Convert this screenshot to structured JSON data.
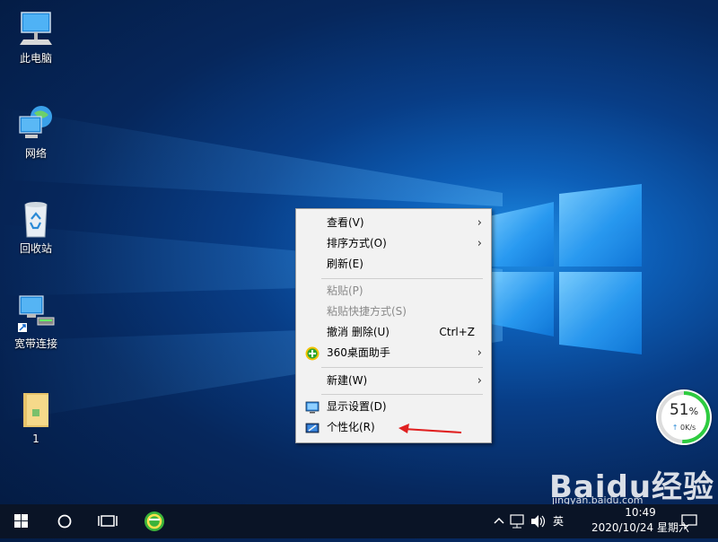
{
  "desktop": {
    "icons": [
      {
        "label": "此电脑",
        "icon": "computer-icon"
      },
      {
        "label": "网络",
        "icon": "network-icon"
      },
      {
        "label": "回收站",
        "icon": "recycle-bin-icon"
      },
      {
        "label": "宽带连接",
        "icon": "broadband-connection-icon"
      },
      {
        "label": "1",
        "icon": "folder-icon"
      }
    ]
  },
  "context_menu": {
    "items": [
      {
        "label": "查看(V)",
        "submenu": true,
        "disabled": false
      },
      {
        "label": "排序方式(O)",
        "submenu": true,
        "disabled": false
      },
      {
        "label": "刷新(E)",
        "submenu": false,
        "disabled": false
      },
      {
        "label": "粘贴(P)",
        "submenu": false,
        "disabled": true
      },
      {
        "label": "粘贴快捷方式(S)",
        "submenu": false,
        "disabled": true
      },
      {
        "label": "撤消 删除(U)",
        "shortcut": "Ctrl+Z",
        "submenu": false,
        "disabled": false
      },
      {
        "label": "360桌面助手",
        "submenu": true,
        "disabled": false,
        "icon": "360-assistant-icon"
      },
      {
        "label": "新建(W)",
        "submenu": true,
        "disabled": false
      },
      {
        "label": "显示设置(D)",
        "submenu": false,
        "disabled": false,
        "icon": "display-settings-icon"
      },
      {
        "label": "个性化(R)",
        "submenu": false,
        "disabled": false,
        "icon": "personalize-icon"
      }
    ]
  },
  "network_widget": {
    "percent": "51",
    "percent_unit": "%",
    "speed": "0K/s"
  },
  "watermark": {
    "brand": "Baidu经验",
    "url": "jingyan.baidu.com"
  },
  "taskbar": {
    "start_icon": "windows-start-icon",
    "search_icon": "cortana-circle-icon",
    "taskview_icon": "task-view-icon",
    "pinned_app_icon": "360-browser-icon",
    "ime": "英",
    "time": "10:49",
    "date": "2020/10/24 星期六"
  },
  "colors": {
    "menu_bg": "#f2f2f2",
    "taskbar_bg": "#0a1426",
    "gauge_ring": "#2ecc40",
    "annotation_arrow": "#e02020"
  }
}
